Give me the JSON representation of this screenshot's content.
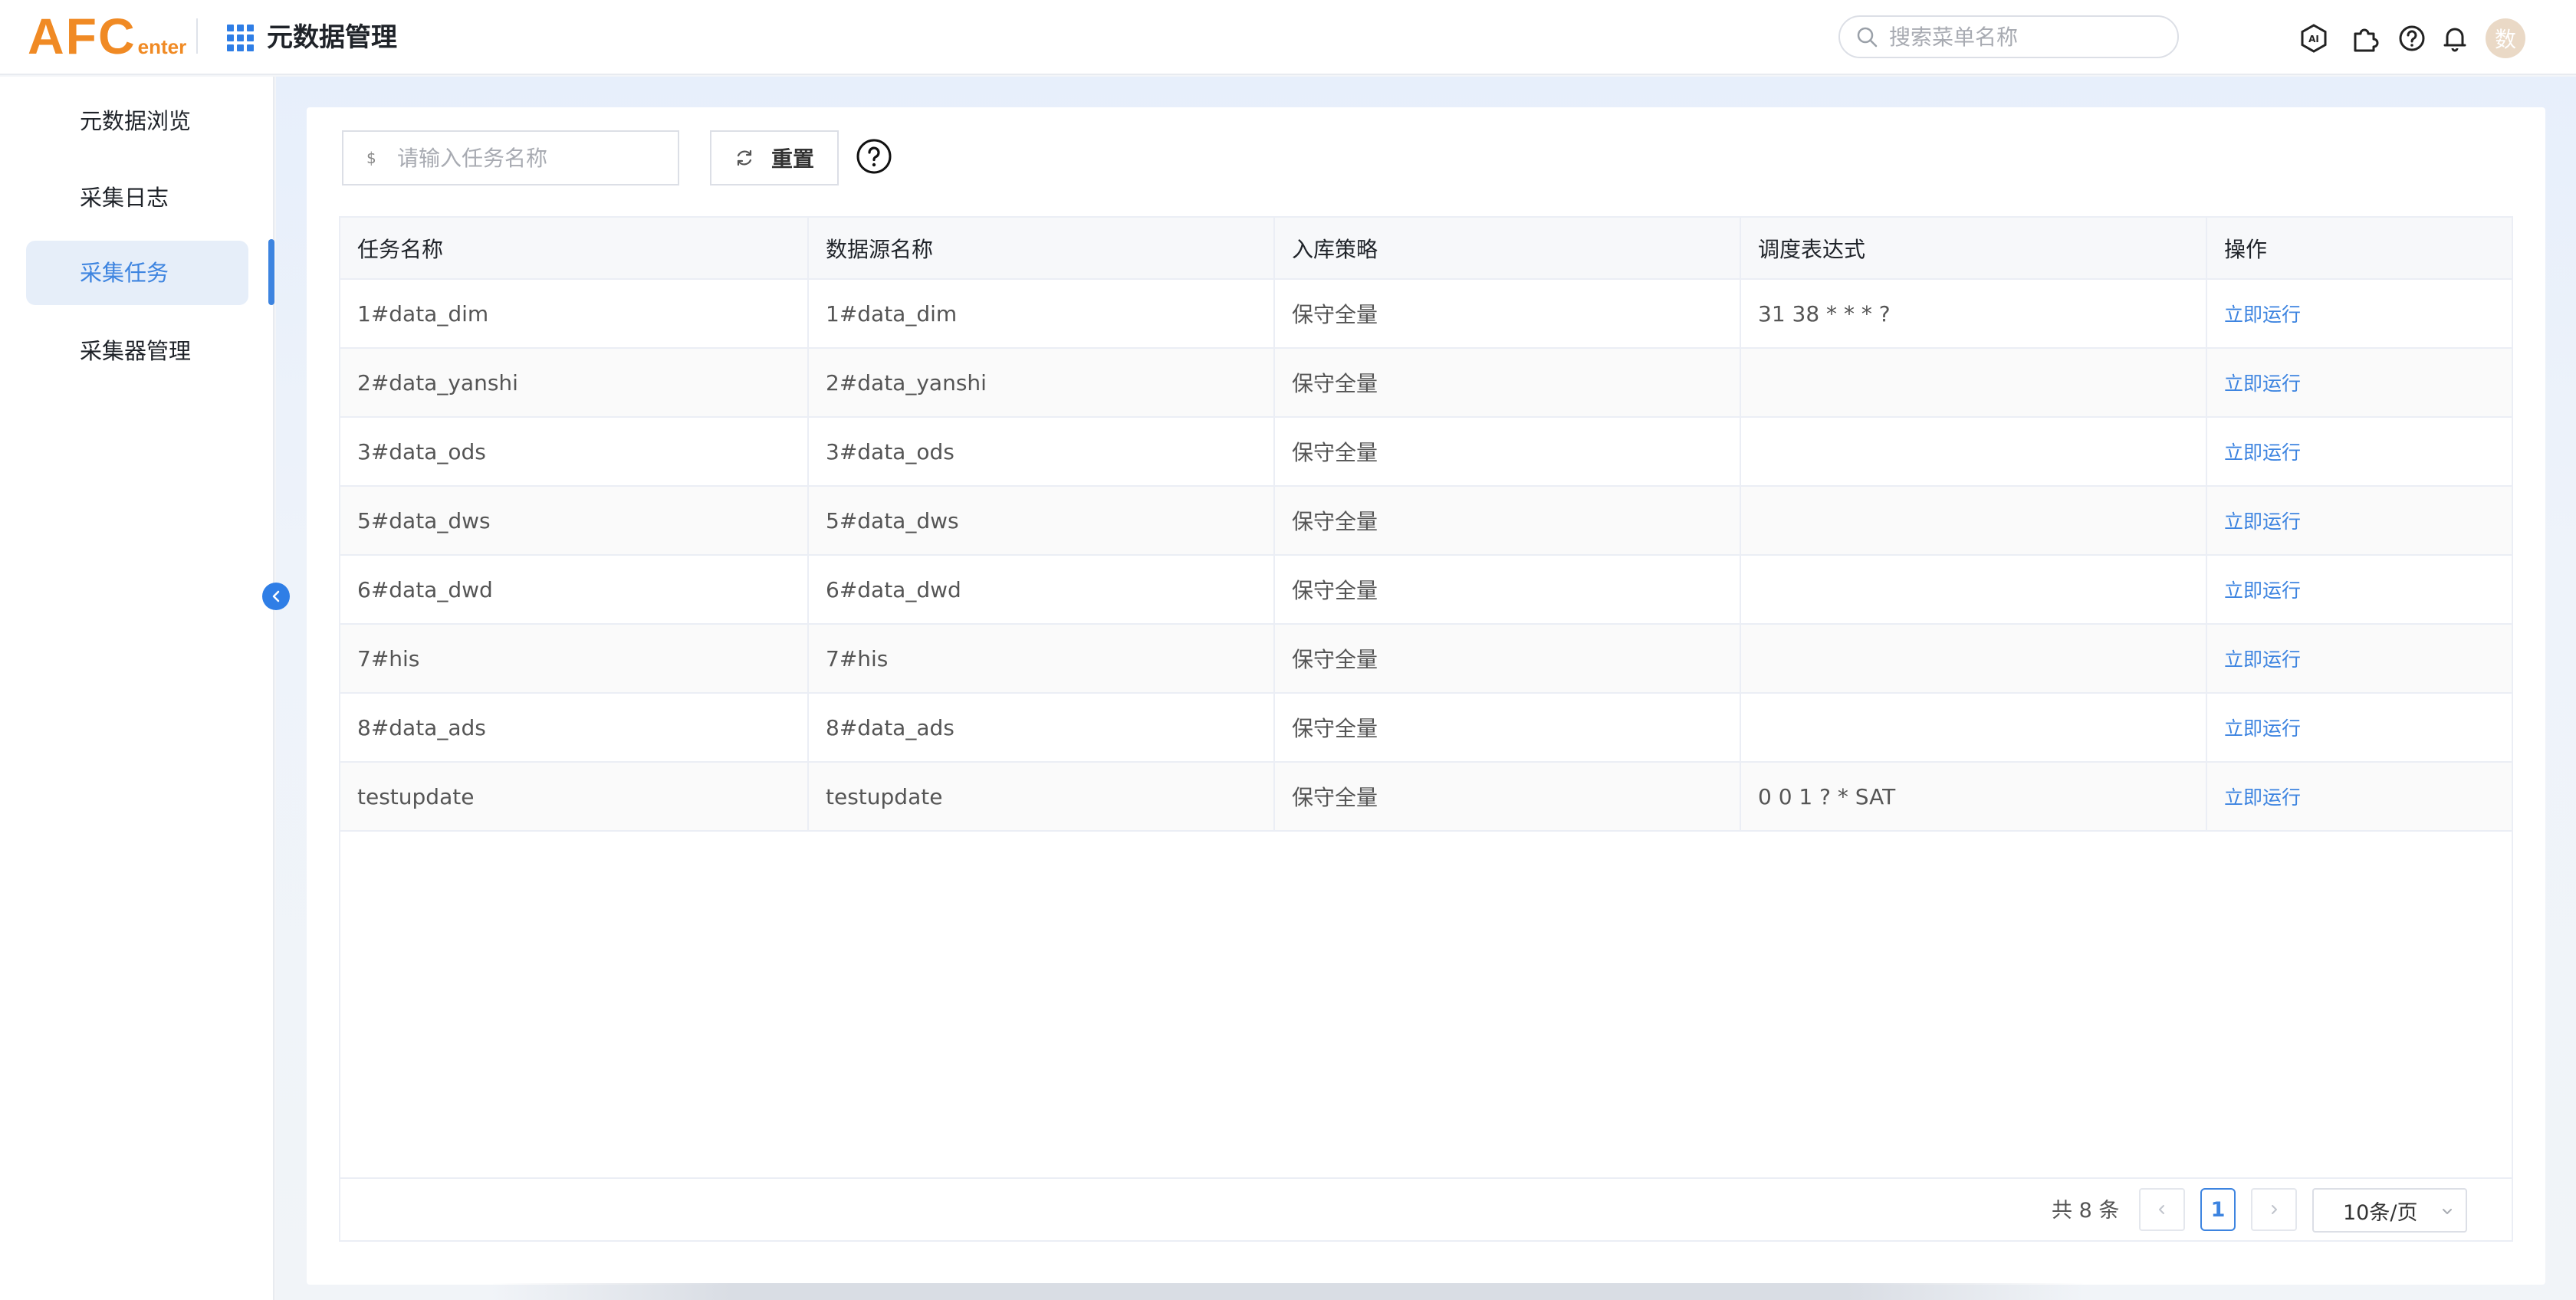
{
  "header": {
    "logo_big": "AFC",
    "logo_small": "enter",
    "module_title": "元数据管理",
    "search_placeholder": "搜索菜单名称",
    "avatar_text": "数"
  },
  "sidebar": {
    "items": [
      {
        "label": "元数据浏览"
      },
      {
        "label": "采集日志"
      },
      {
        "label": "采集任务"
      },
      {
        "label": "采集器管理"
      }
    ],
    "active_index": 2
  },
  "toolbar": {
    "task_input_prefix": "$",
    "task_input_placeholder": "请输入任务名称",
    "task_input_value": "",
    "reset_label": "重置"
  },
  "table": {
    "columns": [
      "任务名称",
      "数据源名称",
      "入库策略",
      "调度表达式",
      "操作"
    ],
    "rows": [
      {
        "name": "1#data_dim",
        "source": "1#data_dim",
        "strategy": "保守全量",
        "cron": "31 38 * * * ?",
        "action": "立即运行"
      },
      {
        "name": "2#data_yanshi",
        "source": "2#data_yanshi",
        "strategy": "保守全量",
        "cron": "",
        "action": "立即运行"
      },
      {
        "name": "3#data_ods",
        "source": "3#data_ods",
        "strategy": "保守全量",
        "cron": "",
        "action": "立即运行"
      },
      {
        "name": "5#data_dws",
        "source": "5#data_dws",
        "strategy": "保守全量",
        "cron": "",
        "action": "立即运行"
      },
      {
        "name": "6#data_dwd",
        "source": "6#data_dwd",
        "strategy": "保守全量",
        "cron": "",
        "action": "立即运行"
      },
      {
        "name": "7#his",
        "source": "7#his",
        "strategy": "保守全量",
        "cron": "",
        "action": "立即运行"
      },
      {
        "name": "8#data_ads",
        "source": "8#data_ads",
        "strategy": "保守全量",
        "cron": "",
        "action": "立即运行"
      },
      {
        "name": "testupdate",
        "source": "testupdate",
        "strategy": "保守全量",
        "cron": "0 0 1 ? * SAT",
        "action": "立即运行"
      }
    ]
  },
  "pagination": {
    "total_text": "共 8 条",
    "current_page": "1",
    "page_size": "10条/页"
  },
  "colors": {
    "accent": "#3d84e0",
    "logo": "#f08a24"
  },
  "icons": [
    "apps-grid-icon",
    "search-icon",
    "ai-icon",
    "plugin-icon",
    "help-icon",
    "bell-icon",
    "refresh-icon",
    "question-icon",
    "chevron-left-icon",
    "chevron-right-icon",
    "chevron-down-icon"
  ]
}
